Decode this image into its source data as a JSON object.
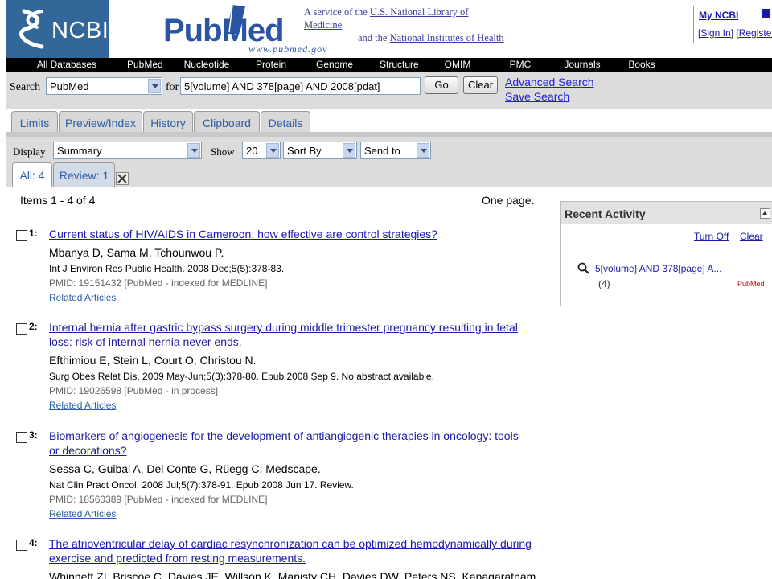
{
  "header": {
    "ncbi_logo_text": "NCBI",
    "pubmed_logo_text": "PubMed",
    "pubmed_url": "www.pubmed.gov",
    "service_line1_prefix": "A service of the",
    "service_line1_link": "U.S. National Library of Medicine",
    "service_line2_prefix": "and the",
    "service_line2_link": "National Institutes of Health",
    "my_ncbi": "My NCBI",
    "sign_in": "[Sign In]",
    "register": "[Register]"
  },
  "topnav": [
    "All Databases",
    "PubMed",
    "Nucleotide",
    "Protein",
    "Genome",
    "Structure",
    "OMIM",
    "PMC",
    "Journals",
    "Books"
  ],
  "search": {
    "label": "Search",
    "database": "PubMed",
    "for_label": "for",
    "query": "5[volume] AND 378[page] AND 2008[pdat]",
    "go": "Go",
    "clear": "Clear",
    "advanced": "Advanced Search",
    "save": "Save Search"
  },
  "tabs": [
    "Limits",
    "Preview/Index",
    "History",
    "Clipboard",
    "Details"
  ],
  "display": {
    "display_label": "Display",
    "display_value": "Summary",
    "show_label": "Show",
    "show_value": "20",
    "sort_value": "Sort By",
    "send_value": "Send to"
  },
  "subtabs": {
    "all": "All: 4",
    "review": "Review: 1"
  },
  "results_info": {
    "items": "Items 1 - 4 of 4",
    "pages": "One page."
  },
  "results": [
    {
      "number": "1:",
      "title": "Current status of HIV/AIDS in Cameroon: how effective are control strategies?",
      "authors": "Mbanya D, Sama M, Tchounwou P.",
      "source": "Int J Environ Res Public Health. 2008 Dec;5(5):378-83.",
      "pmid": "PMID: 19151432 [PubMed - indexed for MEDLINE]",
      "related": "Related Articles"
    },
    {
      "number": "2:",
      "title": "Internal hernia after gastric bypass surgery during middle trimester pregnancy resulting in fetal loss: risk of internal hernia never ends.",
      "authors": "Efthimiou E, Stein L, Court O, Christou N.",
      "source": "Surg Obes Relat Dis. 2009 May-Jun;5(3):378-80. Epub 2008 Sep 9. No abstract available.",
      "pmid": "PMID: 19026598 [PubMed - in process]",
      "related": "Related Articles"
    },
    {
      "number": "3:",
      "title": "Biomarkers of angiogenesis for the development of antiangiogenic therapies in oncology: tools or decorations?",
      "authors": "Sessa C, Guibal A, Del Conte G, Rüegg C; Medscape.",
      "source": "Nat Clin Pract Oncol. 2008 Jul;5(7):378-91. Epub 2008 Jun 17. Review.",
      "pmid": "PMID: 18560389 [PubMed - indexed for MEDLINE]",
      "related": "Related Articles"
    },
    {
      "number": "4:",
      "title": "The atrioventricular delay of cardiac resynchronization can be optimized hemodynamically during exercise and predicted from resting measurements.",
      "authors": "Whinnett ZI, Briscoe C, Davies JE, Willson K, Manisty CH, Davies DW, Peters NS, Kanagaratnam P,"
    }
  ],
  "recent_activity": {
    "title": "Recent Activity",
    "turn_off": "Turn Off",
    "clear": "Clear",
    "entry": "5[volume] AND 378[page] A...",
    "entry_count": "(4)",
    "entry_db": "PubMed"
  },
  "colors": {
    "ncbi_blue": "#336699",
    "link": "#1a1aa6",
    "nav_black": "#000000",
    "bar_gray": "#dcdcdc",
    "pubmed_red": "#cc0000"
  }
}
